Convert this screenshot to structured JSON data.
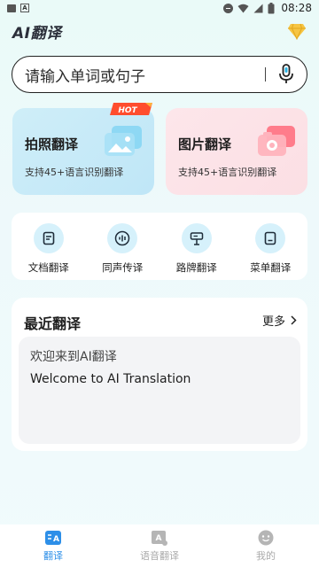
{
  "status_bar": {
    "time": "08:28"
  },
  "header": {
    "title": "AI翻译",
    "vip_icon": "diamond-icon"
  },
  "search": {
    "placeholder": "请输入单词或句子",
    "mic_icon": "microphone-icon"
  },
  "cards": [
    {
      "title": "拍照翻译",
      "subtitle": "支持45+语言识别翻译",
      "badge": "HOT",
      "icon": "camera-photo-icon"
    },
    {
      "title": "图片翻译",
      "subtitle": "支持45+语言识别翻译",
      "icon": "camera-image-icon"
    }
  ],
  "tools": [
    {
      "label": "文档翻译",
      "icon": "document-icon"
    },
    {
      "label": "同声传译",
      "icon": "audio-wave-icon"
    },
    {
      "label": "路牌翻译",
      "icon": "signpost-icon"
    },
    {
      "label": "菜单翻译",
      "icon": "menu-card-icon"
    }
  ],
  "recent": {
    "title": "最近翻译",
    "more_label": "更多",
    "items": [
      {
        "source": "欢迎来到AI翻译",
        "target": "Welcome to AI Translation"
      }
    ]
  },
  "nav": [
    {
      "label": "翻译",
      "icon": "translate-icon",
      "active": true
    },
    {
      "label": "语音翻译",
      "icon": "voice-translate-icon",
      "active": false
    },
    {
      "label": "我的",
      "icon": "profile-icon",
      "active": false
    }
  ],
  "colors": {
    "accent": "#2d8fe8",
    "tool_bg": "#d6f1fb",
    "photo_card": "#cfeef8",
    "image_card": "#fde6ea",
    "hot_badge": "#ff4d2e"
  }
}
